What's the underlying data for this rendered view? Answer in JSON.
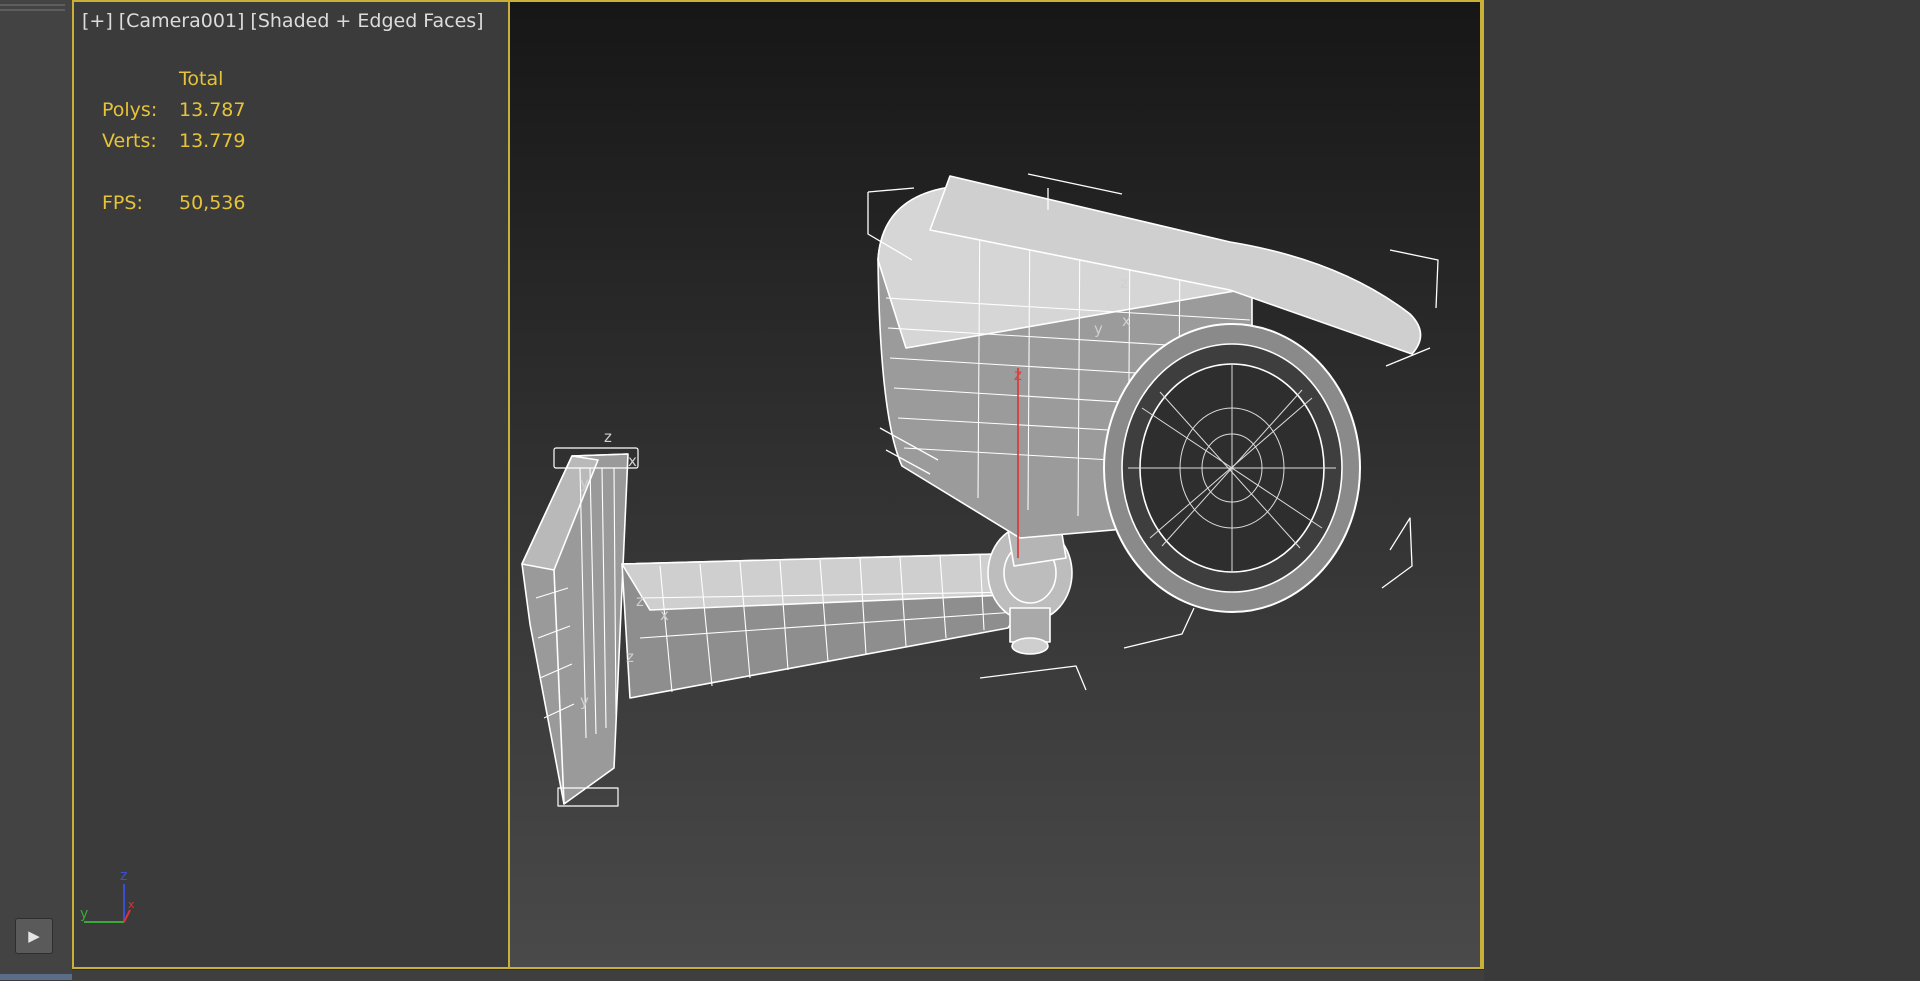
{
  "viewport": {
    "labels": [
      "[+]",
      "[Camera001]",
      "[Shaded + Edged Faces]"
    ],
    "stats": {
      "header": "Total",
      "polys_label": "Polys:",
      "polys_value": "13.787",
      "verts_label": "Verts:",
      "verts_value": "13.779",
      "fps_label": "FPS:",
      "fps_value": "50,536"
    },
    "gizmo_axes": {
      "z": "z",
      "y": "y",
      "x": "x"
    }
  },
  "toolbar": {
    "play_icon": "play-icon"
  },
  "model_axis_labels": {
    "z": "z",
    "y": "y",
    "x": "x"
  },
  "colors": {
    "frame": "#c9b037",
    "stats_text": "#e6c337"
  }
}
